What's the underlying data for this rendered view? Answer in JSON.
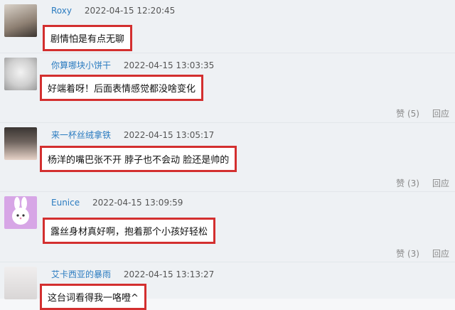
{
  "comments": [
    {
      "user": "Roxy",
      "time": "2022-04-15 12:20:45",
      "text": "剧情怕是有点无聊",
      "likes_label": "",
      "reply_label": ""
    },
    {
      "user": "你算哪块小饼干",
      "time": "2022-04-15 13:03:35",
      "text": "好端着呀！后面表情感觉都没啥变化",
      "likes_label": "赞 (5)",
      "reply_label": "回应"
    },
    {
      "user": "来一杯丝绒拿铁",
      "time": "2022-04-15 13:05:17",
      "text": "杨洋的嘴巴张不开 脖子也不会动 脸还是帅的",
      "likes_label": "赞 (3)",
      "reply_label": "回应"
    },
    {
      "user": "Eunice",
      "time": "2022-04-15 13:09:59",
      "text": "露丝身材真好啊，抱着那个小孩好轻松",
      "likes_label": "赞 (3)",
      "reply_label": "回应"
    },
    {
      "user": "艾卡西亚的暴雨",
      "time": "2022-04-15 13:13:27",
      "text": "这台词看得我一咯噔^",
      "likes_label": "",
      "reply_label": ""
    }
  ]
}
